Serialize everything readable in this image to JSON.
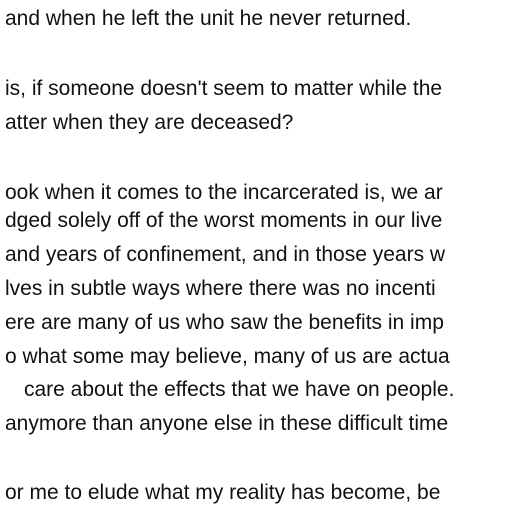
{
  "document": {
    "lines": [
      "and when he left the unit he never returned.",
      "is, if someone doesn't seem to matter while the",
      "atter when they are deceased?",
      "ook when it comes to the incarcerated is, we ar",
      "dged solely off of the worst moments in our live",
      "and years of confinement, and in those years w",
      "lves in subtle ways where there was no incenti",
      "ere are many of us who saw the benefits in imp",
      "o what some may believe, many of us are actua",
      "care about the effects that we have on people.",
      "anymore than anyone else in these difficult time",
      "or me to elude what my reality has become, be"
    ]
  }
}
